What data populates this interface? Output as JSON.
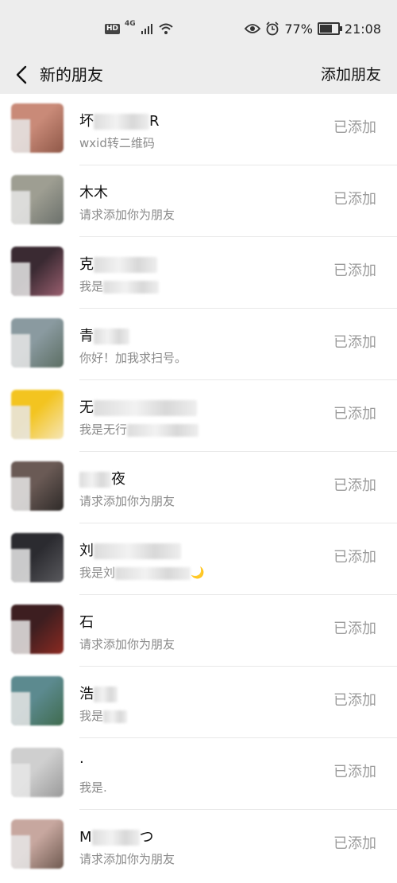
{
  "status_bar": {
    "hd_badge": "HD",
    "network": "4G",
    "battery_percent": "77%",
    "battery_level": 0.77,
    "time": "21:08"
  },
  "nav": {
    "back_icon": "chevron-left-icon",
    "title": "新的朋友",
    "action_label": "添加朋友"
  },
  "requests": [
    {
      "name": "坏",
      "name_suffix": "R",
      "desc": "wxid转二维码",
      "desc_suffix": "",
      "status": "已添加",
      "avatar_colors": [
        "#c98a78",
        "#8f5848"
      ]
    },
    {
      "name": "木木",
      "name_suffix": "",
      "desc": "请求添加你为朋友",
      "desc_suffix": "",
      "status": "已添加",
      "avatar_colors": [
        "#9e9e92",
        "#6b706b"
      ]
    },
    {
      "name": "克",
      "name_suffix": "",
      "desc": "我是",
      "desc_suffix": "",
      "status": "已添加",
      "avatar_colors": [
        "#3a2a32",
        "#9a5f6f"
      ]
    },
    {
      "name": "青",
      "name_suffix": "",
      "desc": "你好！加我求扫号。",
      "desc_suffix": "",
      "status": "已添加",
      "avatar_colors": [
        "#8a9aa0",
        "#5c6e63"
      ]
    },
    {
      "name": "无",
      "name_suffix": "",
      "desc": "我是无行",
      "desc_suffix": "",
      "status": "已添加",
      "avatar_colors": [
        "#f3c420",
        "#f6e6b8"
      ]
    },
    {
      "name": "",
      "name_suffix": "夜",
      "desc": "请求添加你为朋友",
      "desc_suffix": "",
      "status": "已添加",
      "avatar_colors": [
        "#6a5a55",
        "#2e2a28"
      ]
    },
    {
      "name": "刘",
      "name_suffix": "",
      "desc": "我是刘",
      "desc_suffix": "🌙",
      "status": "已添加",
      "avatar_colors": [
        "#2b2b30",
        "#5a5a5e"
      ]
    },
    {
      "name": "石",
      "name_suffix": "",
      "desc": "请求添加你为朋友",
      "desc_suffix": "",
      "status": "已添加",
      "avatar_colors": [
        "#3d1e20",
        "#8c2a22"
      ]
    },
    {
      "name": "浩",
      "name_suffix": "",
      "desc": "我是",
      "desc_suffix": "",
      "status": "已添加",
      "avatar_colors": [
        "#5c8a8f",
        "#3f6b4e"
      ]
    },
    {
      "name": "·",
      "name_suffix": "",
      "desc": "我是.",
      "desc_suffix": "",
      "status": "已添加",
      "avatar_colors": [
        "#cfcfcf",
        "#9a9a9a"
      ]
    },
    {
      "name": "M",
      "name_suffix": "つ",
      "desc": "请求添加你为朋友",
      "desc_suffix": "",
      "status": "已添加",
      "avatar_colors": [
        "#c7a79f",
        "#6f5a50"
      ]
    }
  ]
}
